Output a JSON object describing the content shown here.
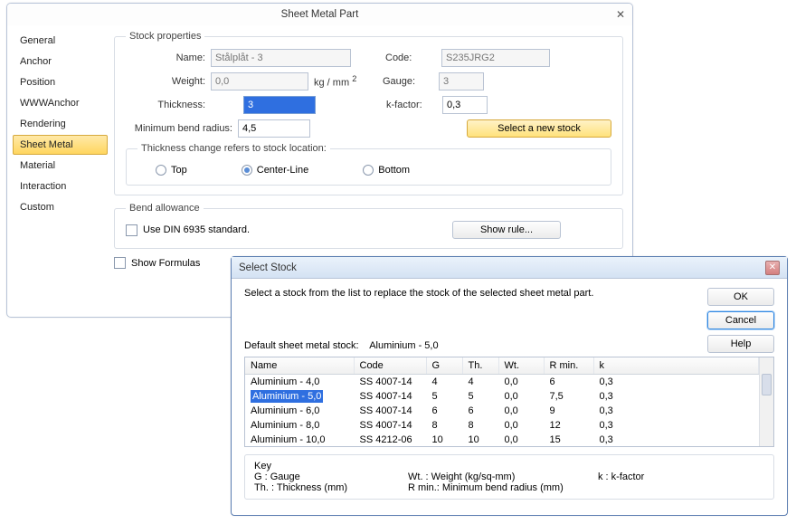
{
  "main_window": {
    "title": "Sheet Metal Part",
    "tabs": {
      "items": [
        "General",
        "Anchor",
        "Position",
        "WWWAnchor",
        "Rendering",
        "Sheet Metal",
        "Material",
        "Interaction",
        "Custom"
      ],
      "selected_index": 5
    },
    "stock_properties": {
      "legend": "Stock properties",
      "name_label": "Name:",
      "name_value": "Stålplåt - 3",
      "code_label": "Code:",
      "code_value": "S235JRG2",
      "weight_label": "Weight:",
      "weight_value": "0,0",
      "weight_units": "kg / mm",
      "weight_units_sup": "2",
      "gauge_label": "Gauge:",
      "gauge_value": "3",
      "thickness_label": "Thickness:",
      "thickness_value": "3",
      "kfactor_label": "k-factor:",
      "kfactor_value": "0,3",
      "min_bend_label": "Minimum bend radius:",
      "min_bend_value": "4,5",
      "select_stock_btn": "Select a new stock",
      "thickness_change": {
        "legend": "Thickness change refers to stock location:",
        "options": {
          "top": "Top",
          "center": "Center-Line",
          "bottom": "Bottom"
        },
        "selected": "center"
      }
    },
    "bend_allowance": {
      "legend": "Bend allowance",
      "use_din_label": "Use DIN 6935 standard.",
      "use_din_checked": false,
      "show_rule_btn": "Show rule..."
    },
    "show_formulas_label": "Show Formulas",
    "show_formulas_checked": false
  },
  "stock_dialog": {
    "title": "Select Stock",
    "instruction": "Select a stock from the list to replace the stock of the selected sheet metal part.",
    "default_label": "Default sheet metal stock:",
    "default_value": "Aluminium - 5,0",
    "buttons": {
      "ok": "OK",
      "cancel": "Cancel",
      "help": "Help"
    },
    "columns": {
      "name": "Name",
      "code": "Code",
      "g": "G",
      "th": "Th.",
      "wt": "Wt.",
      "rmin": "R min.",
      "k": "k"
    },
    "selected_index": 1,
    "rows": [
      {
        "name": "Aluminium - 4,0",
        "code": "SS 4007-14",
        "g": "4",
        "th": "4",
        "wt": "0,0",
        "rmin": "6",
        "k": "0,3"
      },
      {
        "name": "Aluminium - 5,0",
        "code": "SS 4007-14",
        "g": "5",
        "th": "5",
        "wt": "0,0",
        "rmin": "7,5",
        "k": "0,3"
      },
      {
        "name": "Aluminium - 6,0",
        "code": "SS 4007-14",
        "g": "6",
        "th": "6",
        "wt": "0,0",
        "rmin": "9",
        "k": "0,3"
      },
      {
        "name": "Aluminium - 8,0",
        "code": "SS 4007-14",
        "g": "8",
        "th": "8",
        "wt": "0,0",
        "rmin": "12",
        "k": "0,3"
      },
      {
        "name": "Aluminium - 10,0",
        "code": "SS 4212-06",
        "g": "10",
        "th": "10",
        "wt": "0,0",
        "rmin": "15",
        "k": "0,3"
      }
    ],
    "key": {
      "legend": "Key",
      "g": "G : Gauge",
      "wt": "Wt. : Weight (kg/sq-mm)",
      "k": "k : k-factor",
      "th": "Th. : Thickness (mm)",
      "rmin": "R min.: Minimum bend radius (mm)"
    }
  }
}
